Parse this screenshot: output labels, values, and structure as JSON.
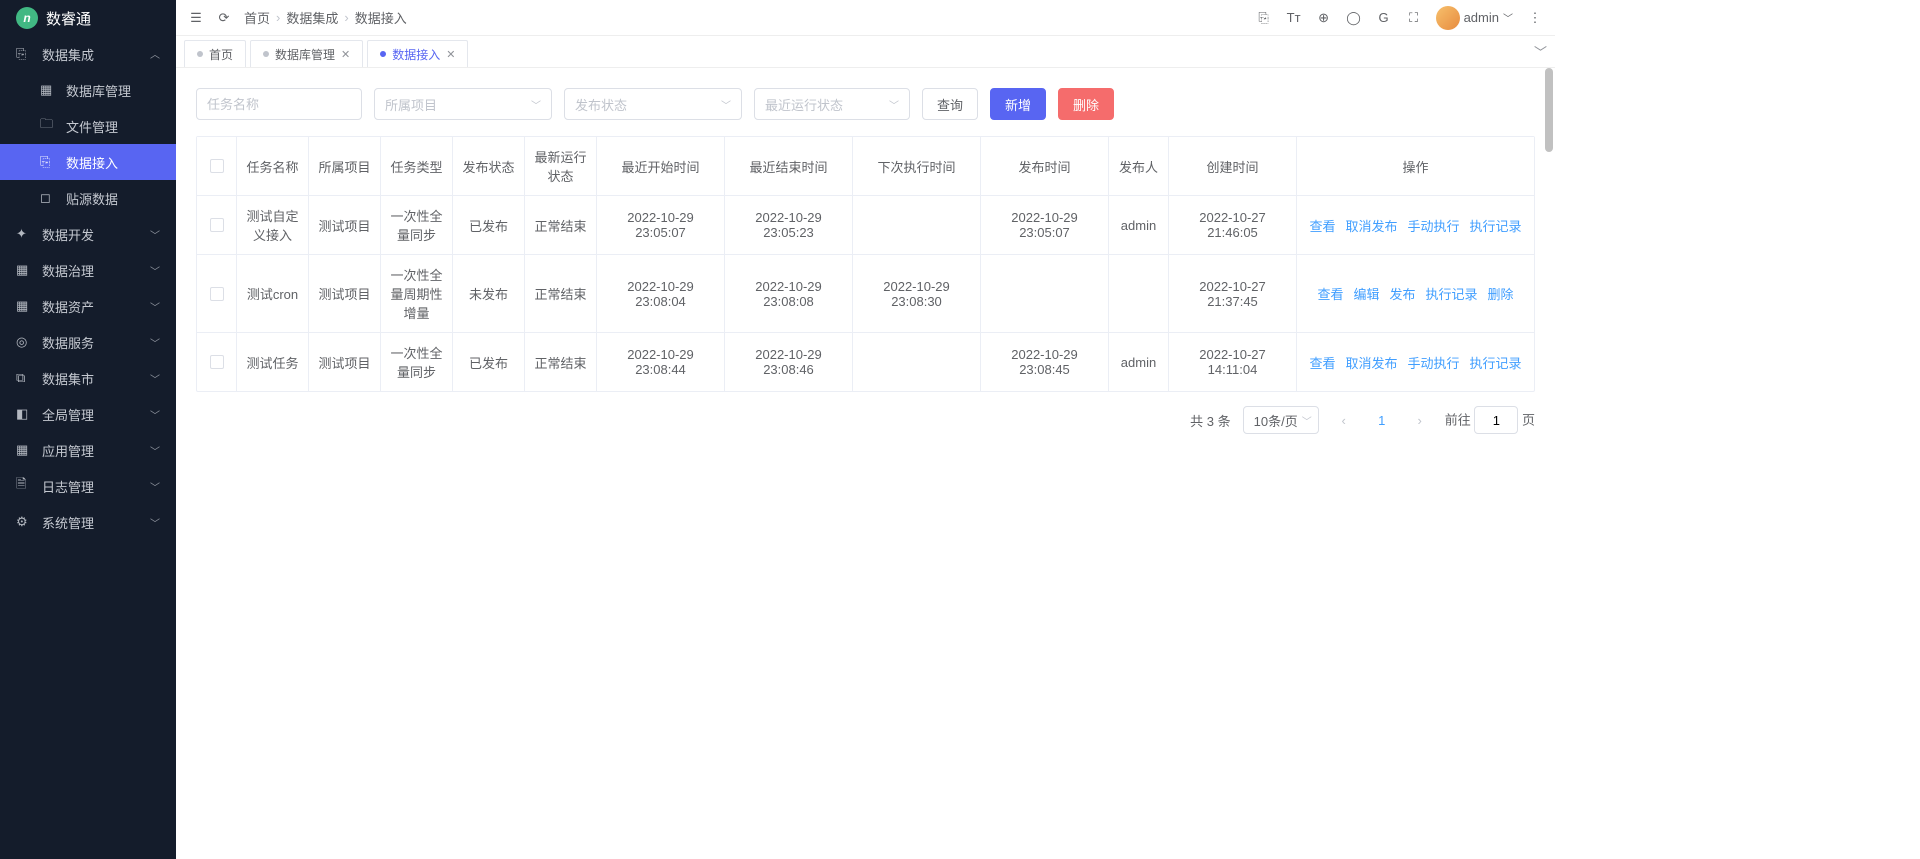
{
  "app": {
    "name": "数睿通",
    "logo_letter": "n"
  },
  "breadcrumb": [
    "首页",
    "数据集成",
    "数据接入"
  ],
  "topbar": {
    "user": "admin"
  },
  "tabs": [
    {
      "label": "首页",
      "closable": false,
      "active": false
    },
    {
      "label": "数据库管理",
      "closable": true,
      "active": false
    },
    {
      "label": "数据接入",
      "closable": true,
      "active": true
    }
  ],
  "sidebar": [
    {
      "label": "数据集成",
      "icon": "⎘",
      "open": true,
      "children": [
        {
          "label": "数据库管理",
          "icon": "▦"
        },
        {
          "label": "文件管理",
          "icon": "🗀"
        },
        {
          "label": "数据接入",
          "icon": "⎘",
          "active": true
        },
        {
          "label": "贴源数据",
          "icon": "◻"
        }
      ]
    },
    {
      "label": "数据开发",
      "icon": "✦"
    },
    {
      "label": "数据治理",
      "icon": "▦"
    },
    {
      "label": "数据资产",
      "icon": "▦"
    },
    {
      "label": "数据服务",
      "icon": "◎"
    },
    {
      "label": "数据集市",
      "icon": "⧉"
    },
    {
      "label": "全局管理",
      "icon": "◧"
    },
    {
      "label": "应用管理",
      "icon": "▦"
    },
    {
      "label": "日志管理",
      "icon": "🗎"
    },
    {
      "label": "系统管理",
      "icon": "⚙"
    }
  ],
  "filters": {
    "task_name_placeholder": "任务名称",
    "project_placeholder": "所属项目",
    "publish_status_placeholder": "发布状态",
    "run_status_placeholder": "最近运行状态",
    "query_btn": "查询",
    "add_btn": "新增",
    "delete_btn": "删除"
  },
  "table": {
    "headers": {
      "name": "任务名称",
      "project": "所属项目",
      "type": "任务类型",
      "pub_status": "发布状态",
      "run_status": "最新运行状态",
      "start": "最近开始时间",
      "end": "最近结束时间",
      "next": "下次执行时间",
      "pub_time": "发布时间",
      "pub_user": "发布人",
      "create_time": "创建时间",
      "ops": "操作"
    },
    "rows": [
      {
        "name": "测试自定义接入",
        "project": "测试项目",
        "type": "一次性全量同步",
        "pub_status": "已发布",
        "run_status": "正常结束",
        "start": "2022-10-29 23:05:07",
        "end": "2022-10-29 23:05:23",
        "next": "",
        "pub_time": "2022-10-29 23:05:07",
        "pub_user": "admin",
        "create_time": "2022-10-27 21:46:05",
        "ops": [
          "查看",
          "取消发布",
          "手动执行",
          "执行记录"
        ]
      },
      {
        "name": "测试cron",
        "project": "测试项目",
        "type": "一次性全量周期性增量",
        "pub_status": "未发布",
        "run_status": "正常结束",
        "start": "2022-10-29 23:08:04",
        "end": "2022-10-29 23:08:08",
        "next": "2022-10-29 23:08:30",
        "pub_time": "",
        "pub_user": "",
        "create_time": "2022-10-27 21:37:45",
        "ops": [
          "查看",
          "编辑",
          "发布",
          "执行记录",
          "删除"
        ]
      },
      {
        "name": "测试任务",
        "project": "测试项目",
        "type": "一次性全量同步",
        "pub_status": "已发布",
        "run_status": "正常结束",
        "start": "2022-10-29 23:08:44",
        "end": "2022-10-29 23:08:46",
        "next": "",
        "pub_time": "2022-10-29 23:08:45",
        "pub_user": "admin",
        "create_time": "2022-10-27 14:11:04",
        "ops": [
          "查看",
          "取消发布",
          "手动执行",
          "执行记录"
        ]
      }
    ]
  },
  "pagination": {
    "total_prefix": "共",
    "total": 3,
    "total_suffix": "条",
    "page_size": "10条/页",
    "current": 1,
    "goto_prefix": "前往",
    "goto_value": 1,
    "goto_suffix": "页"
  }
}
